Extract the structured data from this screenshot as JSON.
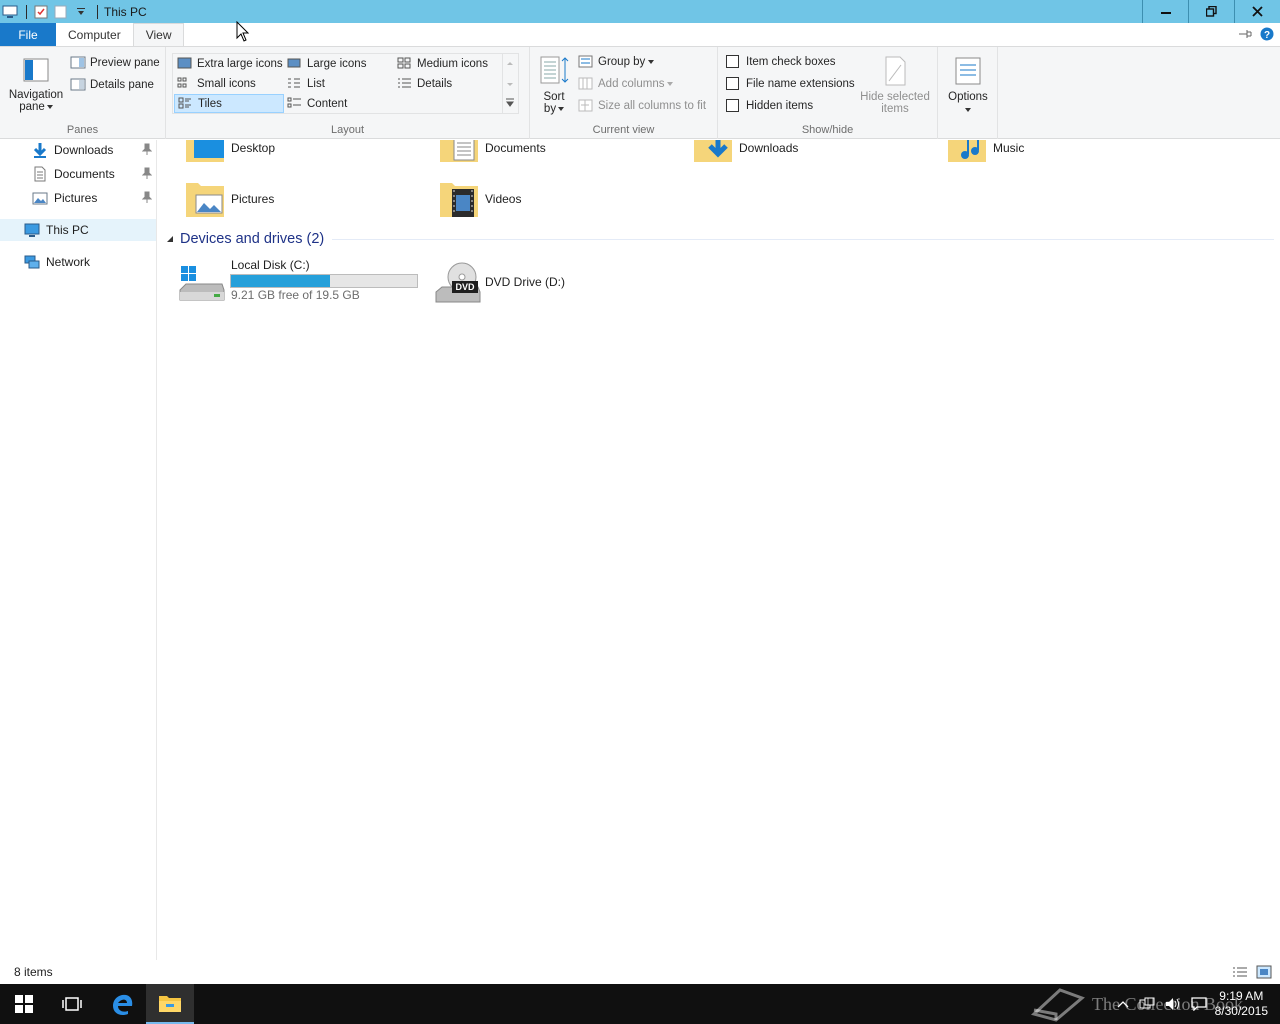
{
  "window": {
    "title": "This PC",
    "qat_items": [
      "computer-icon",
      "properties-icon",
      "new-folder-icon",
      "customize-qat-icon"
    ]
  },
  "tabs": {
    "file": "File",
    "computer": "Computer",
    "view": "View"
  },
  "ribbon": {
    "panes": {
      "nav_pane_line1": "Navigation",
      "nav_pane_line2": "pane",
      "preview_pane": "Preview pane",
      "details_pane": "Details pane",
      "label": "Panes"
    },
    "layout": {
      "extra_large": "Extra large icons",
      "large": "Large icons",
      "medium": "Medium icons",
      "small": "Small icons",
      "list": "List",
      "details": "Details",
      "tiles": "Tiles",
      "content": "Content",
      "label": "Layout",
      "selected": "Tiles"
    },
    "current_view": {
      "sort_line1": "Sort",
      "sort_line2": "by",
      "group_by": "Group by",
      "add_columns": "Add columns",
      "size_columns": "Size all columns to fit",
      "label": "Current view"
    },
    "show_hide": {
      "item_check_boxes": "Item check boxes",
      "file_name_extensions": "File name extensions",
      "hidden_items": "Hidden items",
      "hide_selected_line1": "Hide selected",
      "hide_selected_line2": "items",
      "label": "Show/hide"
    },
    "options": {
      "label": "Options"
    }
  },
  "nav": {
    "items": [
      {
        "label": "Downloads",
        "icon": "downloads-icon",
        "pinned": true
      },
      {
        "label": "Documents",
        "icon": "documents-icon",
        "pinned": true
      },
      {
        "label": "Pictures",
        "icon": "pictures-icon",
        "pinned": true
      },
      {
        "label": "This PC",
        "icon": "this-pc-icon",
        "selected": true
      },
      {
        "label": "Network",
        "icon": "network-icon"
      }
    ]
  },
  "content": {
    "folders": [
      {
        "label": "Desktop"
      },
      {
        "label": "Documents"
      },
      {
        "label": "Downloads"
      },
      {
        "label": "Music"
      },
      {
        "label": "Pictures"
      },
      {
        "label": "Videos"
      }
    ],
    "devices_header": "Devices and drives (2)",
    "drives": [
      {
        "label": "Local Disk (C:)",
        "free_text": "9.21 GB free of 19.5 GB",
        "used_fraction": 0.53
      },
      {
        "label": "DVD Drive (D:)",
        "badge": "DVD"
      }
    ]
  },
  "status": {
    "count": "8 items"
  },
  "taskbar": {
    "time": "9:19 AM",
    "date": "8/30/2015",
    "watermark": "The Collection Book"
  },
  "colors": {
    "titlebar": "#70c5e6",
    "file_tab": "#1979ca",
    "drive_bar": "#26a0da",
    "taskbar": "#101010"
  }
}
